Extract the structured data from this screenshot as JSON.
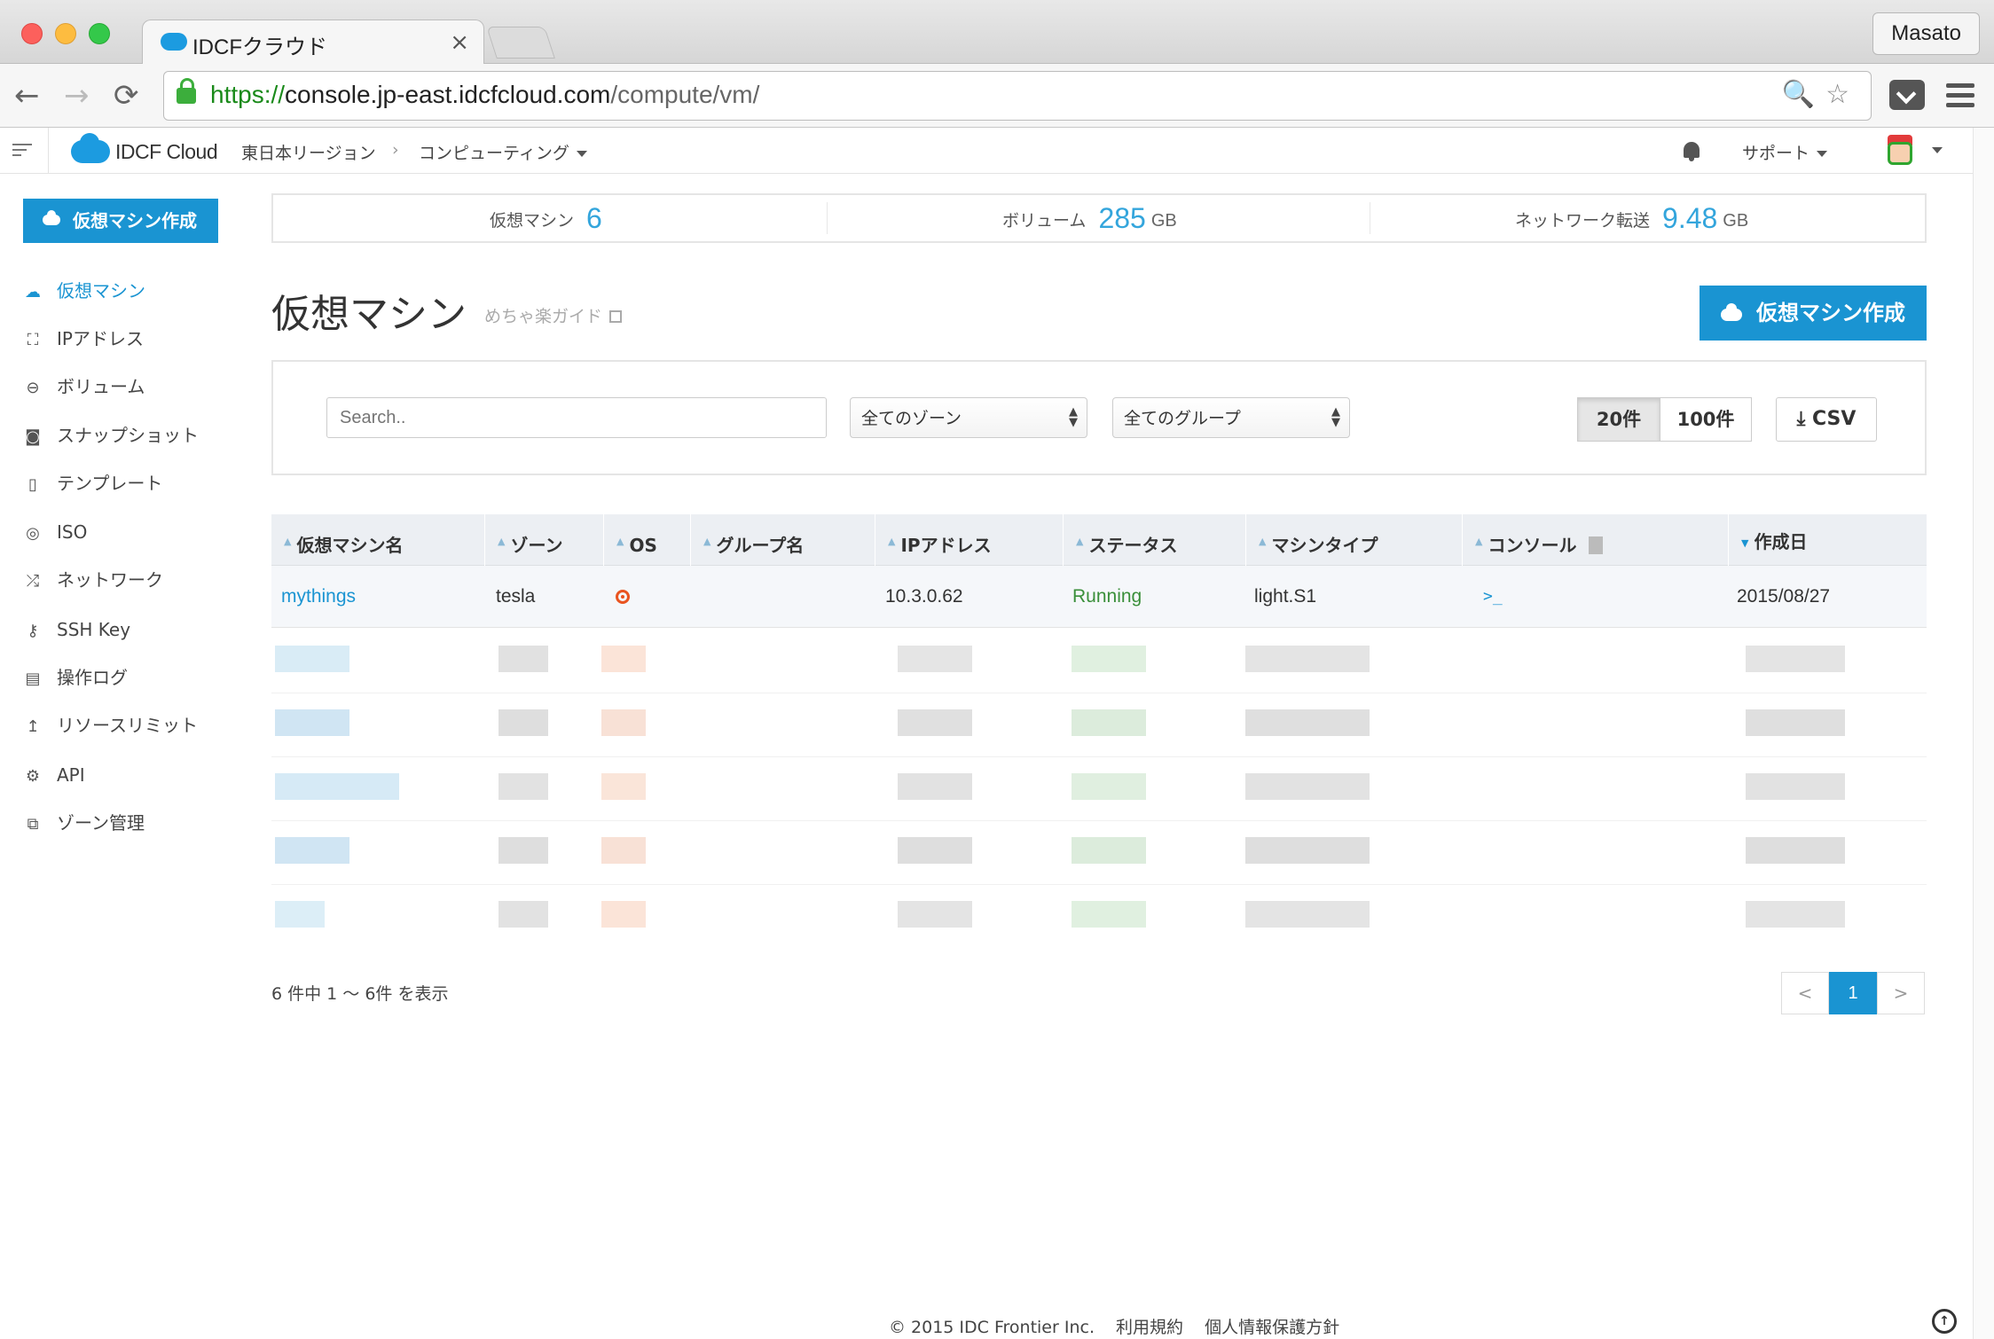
{
  "browser": {
    "tab_title": "IDCFクラウド",
    "tab_close": "×",
    "profile": "Masato",
    "url_scheme": "https://",
    "url_host": "console.jp-east.idcfcloud.com",
    "url_path": "/compute/vm/",
    "nav_back": "←",
    "nav_forward": "→",
    "nav_reload": "⟳",
    "addr_icons": "🔍☆"
  },
  "header": {
    "logo": "IDCF Cloud",
    "region": "東日本リージョン",
    "separator": "›",
    "service": "コンピューティング",
    "support": "サポート"
  },
  "sidebar": {
    "create_label": "仮想マシン作成",
    "items": [
      {
        "label": "仮想マシン",
        "icon": "☁"
      },
      {
        "label": "IPアドレス",
        "icon": "⛶"
      },
      {
        "label": "ボリューム",
        "icon": "⊖"
      },
      {
        "label": "スナップショット",
        "icon": "◙"
      },
      {
        "label": "テンプレート",
        "icon": "▯"
      },
      {
        "label": "ISO",
        "icon": "◎"
      },
      {
        "label": "ネットワーク",
        "icon": "⤮"
      },
      {
        "label": "SSH Key",
        "icon": "⚷"
      },
      {
        "label": "操作ログ",
        "icon": "▤"
      },
      {
        "label": "リソースリミット",
        "icon": "↥"
      },
      {
        "label": "API",
        "icon": "⚙"
      },
      {
        "label": "ゾーン管理",
        "icon": "⧉"
      }
    ]
  },
  "stats": {
    "vm_label": "仮想マシン",
    "vm_count": "6",
    "volume_label": "ボリューム",
    "volume_value": "285",
    "volume_unit": "GB",
    "transfer_label": "ネットワーク転送",
    "transfer_value": "9.48",
    "transfer_unit": "GB"
  },
  "main": {
    "title": "仮想マシン",
    "guide_link": "めちゃ楽ガイド",
    "create_button": "仮想マシン作成"
  },
  "filters": {
    "search_placeholder": "Search..",
    "zone_select": "全てのゾーン",
    "group_select": "全てのグループ",
    "page_size_20": "20件",
    "page_size_100": "100件",
    "csv_button": "CSV",
    "csv_icon": "⤓"
  },
  "table": {
    "columns": [
      "仮想マシン名",
      "ゾーン",
      "OS",
      "グループ名",
      "IPアドレス",
      "ステータス",
      "マシンタイプ",
      "コンソール",
      "作成日"
    ],
    "rows": [
      {
        "name": "mythings",
        "zone": "tesla",
        "os_icon": "ubuntu-icon",
        "group": "",
        "ip": "10.3.0.62",
        "status": "Running",
        "machine_type": "light.S1",
        "console": ">_",
        "created": "2015/08/27"
      }
    ]
  },
  "footer": {
    "count_text": "6 件中 1 〜 6件 を表示",
    "pager_prev": "<",
    "pager_current": "1",
    "pager_next": ">",
    "copyright": "© 2015 IDC Frontier Inc.",
    "terms": "利用規約",
    "privacy": "個人情報保護方針",
    "to_top": "↑"
  },
  "colors": {
    "accent": "#1a94d2",
    "stat_number": "#33a5dc",
    "running": "#3a8f3a"
  }
}
